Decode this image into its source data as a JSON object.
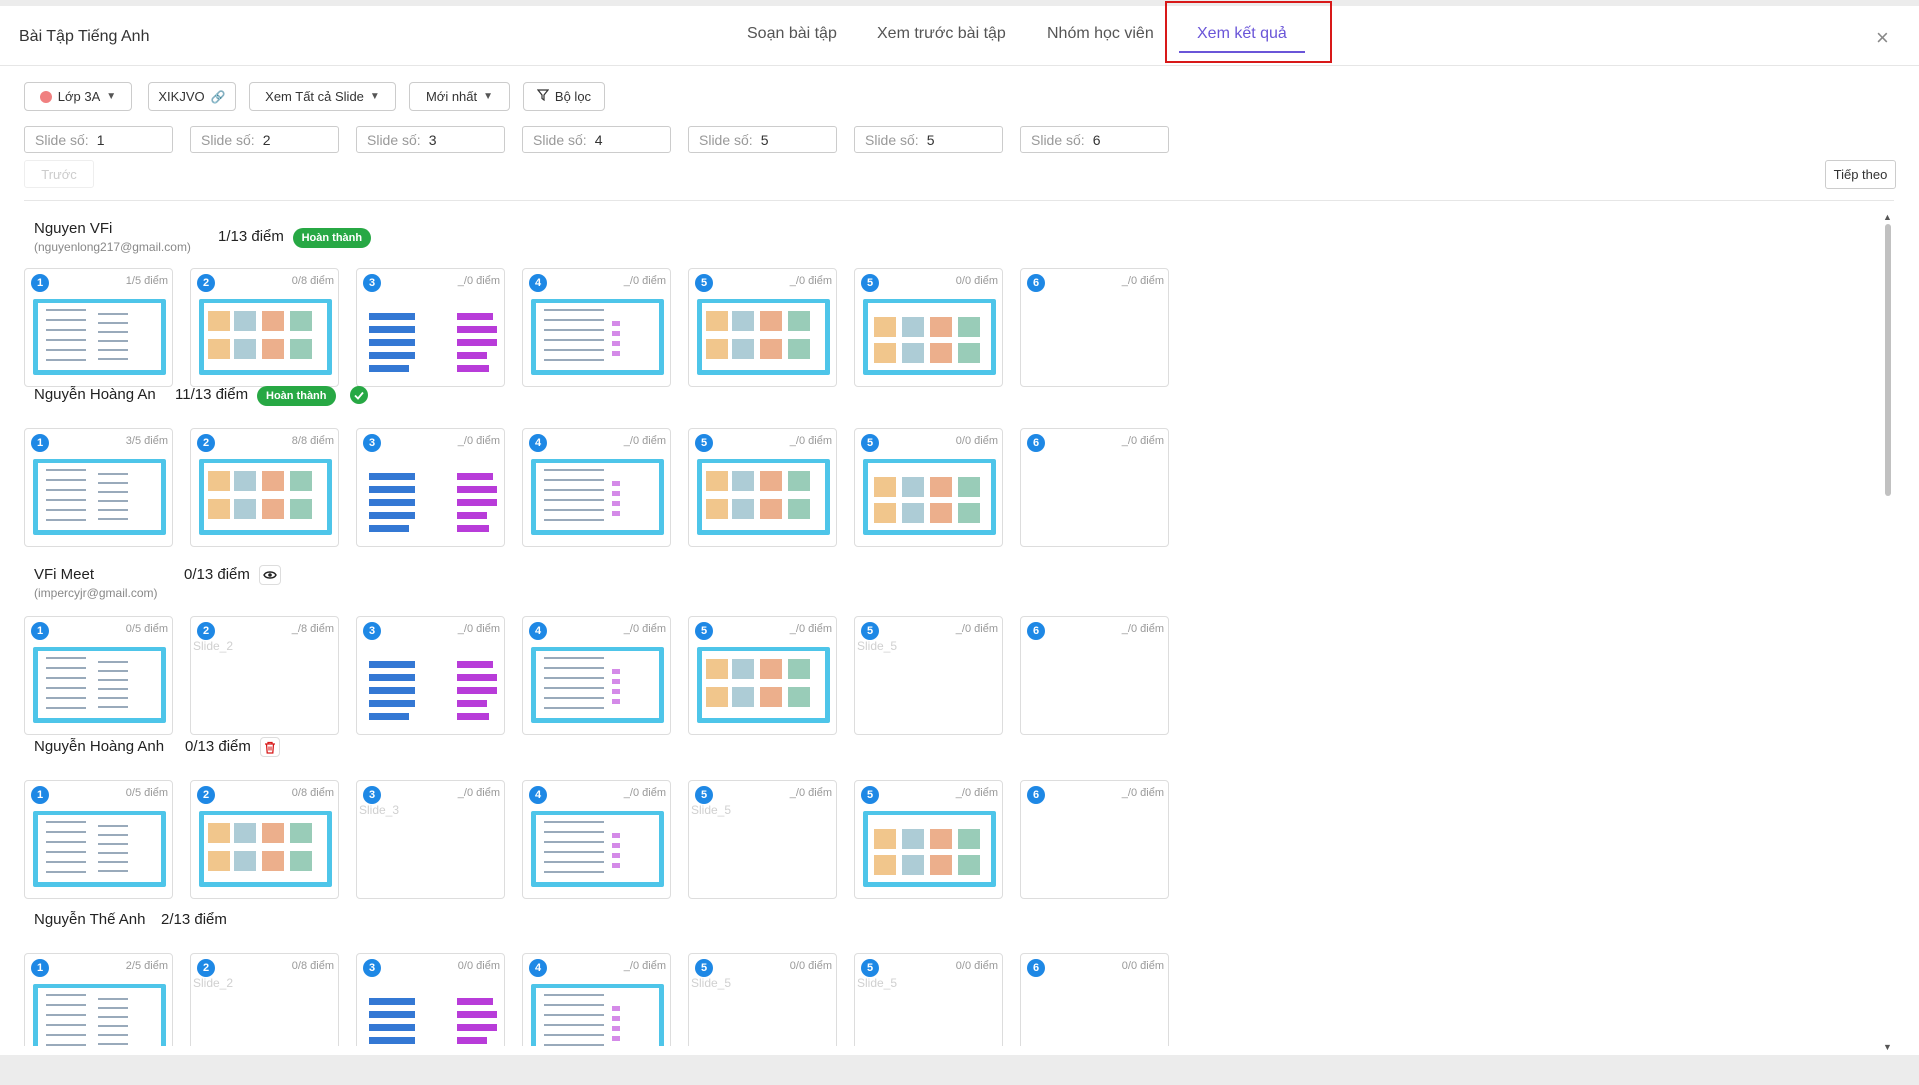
{
  "header": {
    "title": "Bài Tập Tiếng Anh",
    "tabs": [
      "Soạn bài tập",
      "Xem trước bài tập",
      "Nhóm học viên",
      "Xem kết quả"
    ],
    "active_tab": "Xem kết quả",
    "close_icon": "close-icon"
  },
  "toolbar": {
    "class_select": "Lớp 3A",
    "class_color": "#f08080",
    "code": "XIKJVO",
    "slide_view_select": "Xem Tất cả Slide",
    "sort_select": "Mới nhất",
    "filter_label": "Bộ lọc"
  },
  "slide_numbers": {
    "label": "Slide số:",
    "values": [
      "1",
      "2",
      "3",
      "4",
      "5",
      "5",
      "6"
    ]
  },
  "pager": {
    "prev": "Trước",
    "next": "Tiếp theo"
  },
  "colors": {
    "accent": "#6a55d8",
    "badge_green": "#27a844",
    "slide_num_blue": "#1e88e5",
    "highlight_red": "#d81919"
  },
  "students": [
    {
      "name": "Nguyen VFi",
      "email": "(nguyenlong217@gmail.com)",
      "score": "1/13 điểm",
      "badge": "Hoàn thành",
      "slides": [
        {
          "num": "1",
          "score": "1/5 điểm"
        },
        {
          "num": "2",
          "score": "0/8 điểm"
        },
        {
          "num": "3",
          "score": "_/0 điểm"
        },
        {
          "num": "4",
          "score": "_/0 điểm"
        },
        {
          "num": "5",
          "score": "_/0 điểm"
        },
        {
          "num": "5",
          "score": "0/0 điểm"
        },
        {
          "num": "6",
          "score": "_/0 điểm"
        }
      ]
    },
    {
      "name": "Nguyễn Hoàng An",
      "score": "11/13 điểm",
      "badge": "Hoàn thành",
      "action_icon": "check-circle-icon",
      "slides": [
        {
          "num": "1",
          "score": "3/5 điểm"
        },
        {
          "num": "2",
          "score": "8/8 điểm"
        },
        {
          "num": "3",
          "score": "_/0 điểm"
        },
        {
          "num": "4",
          "score": "_/0 điểm"
        },
        {
          "num": "5",
          "score": "_/0 điểm"
        },
        {
          "num": "5",
          "score": "0/0 điểm"
        },
        {
          "num": "6",
          "score": "_/0 điểm"
        }
      ]
    },
    {
      "name": "VFi Meet",
      "email": "(impercyjr@gmail.com)",
      "score": "0/13 điểm",
      "action_icon": "eye-icon",
      "slides": [
        {
          "num": "1",
          "score": "0/5 điểm"
        },
        {
          "num": "2",
          "score": "_/8 điểm",
          "broken_alt": "Slide_2"
        },
        {
          "num": "3",
          "score": "_/0 điểm"
        },
        {
          "num": "4",
          "score": "_/0 điểm"
        },
        {
          "num": "5",
          "score": "_/0 điểm"
        },
        {
          "num": "5",
          "score": "_/0 điểm",
          "broken_alt": "Slide_5"
        },
        {
          "num": "6",
          "score": "_/0 điểm"
        }
      ]
    },
    {
      "name": "Nguyễn Hoàng Anh",
      "score": "0/13 điểm",
      "action_icon": "trash-icon",
      "slides": [
        {
          "num": "1",
          "score": "0/5 điểm"
        },
        {
          "num": "2",
          "score": "0/8 điểm"
        },
        {
          "num": "3",
          "score": "_/0 điểm",
          "broken_alt": "Slide_3"
        },
        {
          "num": "4",
          "score": "_/0 điểm"
        },
        {
          "num": "5",
          "score": "_/0 điểm",
          "broken_alt": "Slide_5"
        },
        {
          "num": "5",
          "score": "_/0 điểm"
        },
        {
          "num": "6",
          "score": "_/0 điểm"
        }
      ]
    },
    {
      "name": "Nguyễn Thế Anh",
      "score": "2/13 điểm",
      "slides": [
        {
          "num": "1",
          "score": "2/5 điểm"
        },
        {
          "num": "2",
          "score": "0/8 điểm",
          "broken_alt": "Slide_2"
        },
        {
          "num": "3",
          "score": "0/0 điểm"
        },
        {
          "num": "4",
          "score": "_/0 điểm"
        },
        {
          "num": "5",
          "score": "0/0 điểm",
          "broken_alt": "Slide_5"
        },
        {
          "num": "5",
          "score": "0/0 điểm",
          "broken_alt": "Slide_5"
        },
        {
          "num": "6",
          "score": "0/0 điểm"
        }
      ]
    }
  ]
}
